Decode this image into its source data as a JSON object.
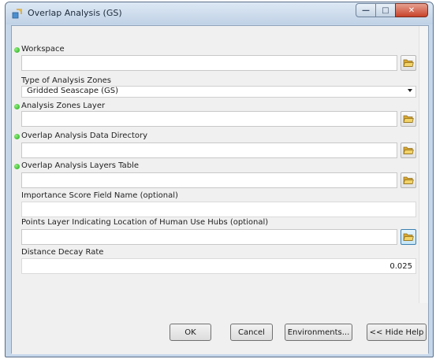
{
  "window": {
    "title": "Overlap Analysis (GS)",
    "controls": {
      "minimize_glyph": "—",
      "maximize_glyph": "□",
      "close_glyph": "✕"
    }
  },
  "parameters": {
    "workspace": {
      "label": "Workspace",
      "value": "",
      "required": true
    },
    "analysis_zone_type": {
      "label": "Type of Analysis Zones",
      "selected": "Gridded Seascape (GS)"
    },
    "analysis_zones_layer": {
      "label": "Analysis Zones Layer",
      "value": "",
      "required": true
    },
    "data_directory": {
      "label": "Overlap Analysis Data Directory",
      "value": "",
      "required": true
    },
    "layers_table": {
      "label": "Overlap Analysis Layers Table",
      "value": "",
      "required": true
    },
    "importance_field": {
      "label": "Importance Score Field Name (optional)",
      "value": ""
    },
    "human_use_hubs": {
      "label": "Points Layer Indicating Location of Human Use Hubs (optional)",
      "value": ""
    },
    "distance_decay": {
      "label": "Distance Decay Rate",
      "value": "0.025"
    }
  },
  "buttons": {
    "ok": "OK",
    "cancel": "Cancel",
    "environments": "Environments...",
    "hide_help": "<< Hide Help"
  },
  "icons": {
    "app": "arcgis-tool-icon",
    "browse": "open-folder-icon",
    "required": "green-dot-icon"
  },
  "colors": {
    "title_bar": "#c6d7ea",
    "close_button": "#c8432b",
    "required_dot": "#22a51d",
    "folder": "#e7c24a"
  }
}
